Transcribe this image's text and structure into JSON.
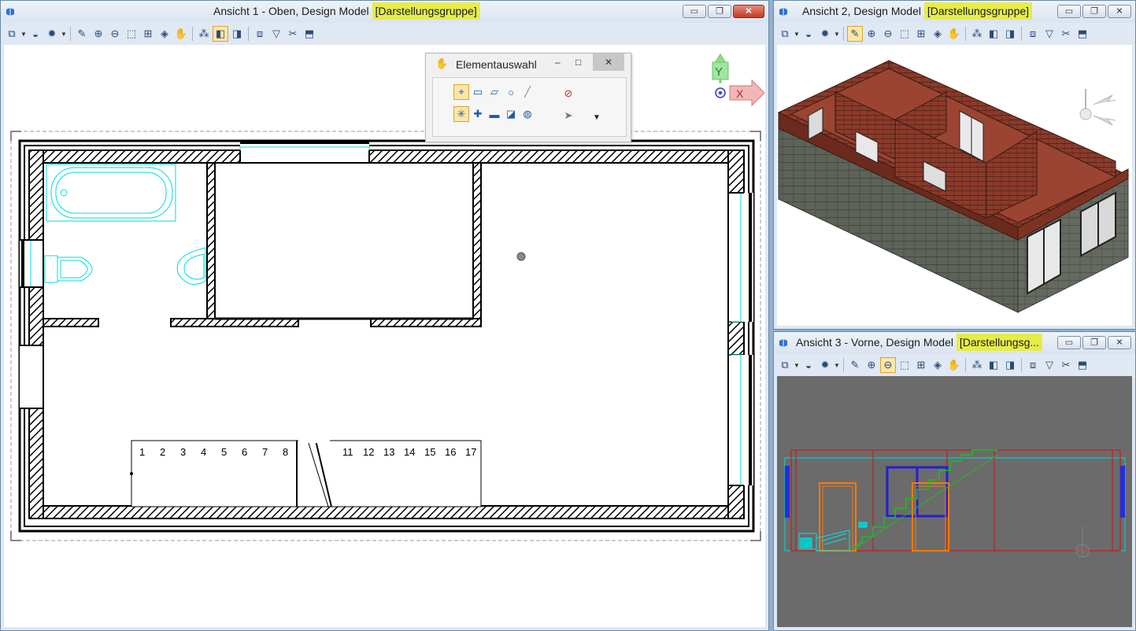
{
  "view1": {
    "title": "Ansicht 1 - Oben, Design Model ",
    "group": "[Darstellungsgruppe]"
  },
  "view2": {
    "title": "Ansicht 2, Design Model ",
    "group": "[Darstellungsgruppe]"
  },
  "view3": {
    "title": "Ansicht 3 - Vorne, Design Model ",
    "group": "[Darstellungsg..."
  },
  "window_buttons": {
    "minimize": "▭",
    "restore": "❐",
    "close": "✕"
  },
  "element_selection": {
    "title": "Elementauswahl",
    "minimize": "–",
    "maximize": "□",
    "close": "✕"
  },
  "triad": {
    "y_label": "Y",
    "x_label": "X"
  },
  "stair_numbers": [
    "1",
    "2",
    "3",
    "4",
    "5",
    "6",
    "7",
    "8",
    "11",
    "12",
    "13",
    "14",
    "15",
    "16",
    "17"
  ],
  "colors": {
    "highlight": "#e6ec4a",
    "cyan": "#00e5e5",
    "close_red": "#c23b22",
    "brick": "#7a3426",
    "stone": "#5b5f56",
    "elevation_bg": "#6b6b6b"
  }
}
